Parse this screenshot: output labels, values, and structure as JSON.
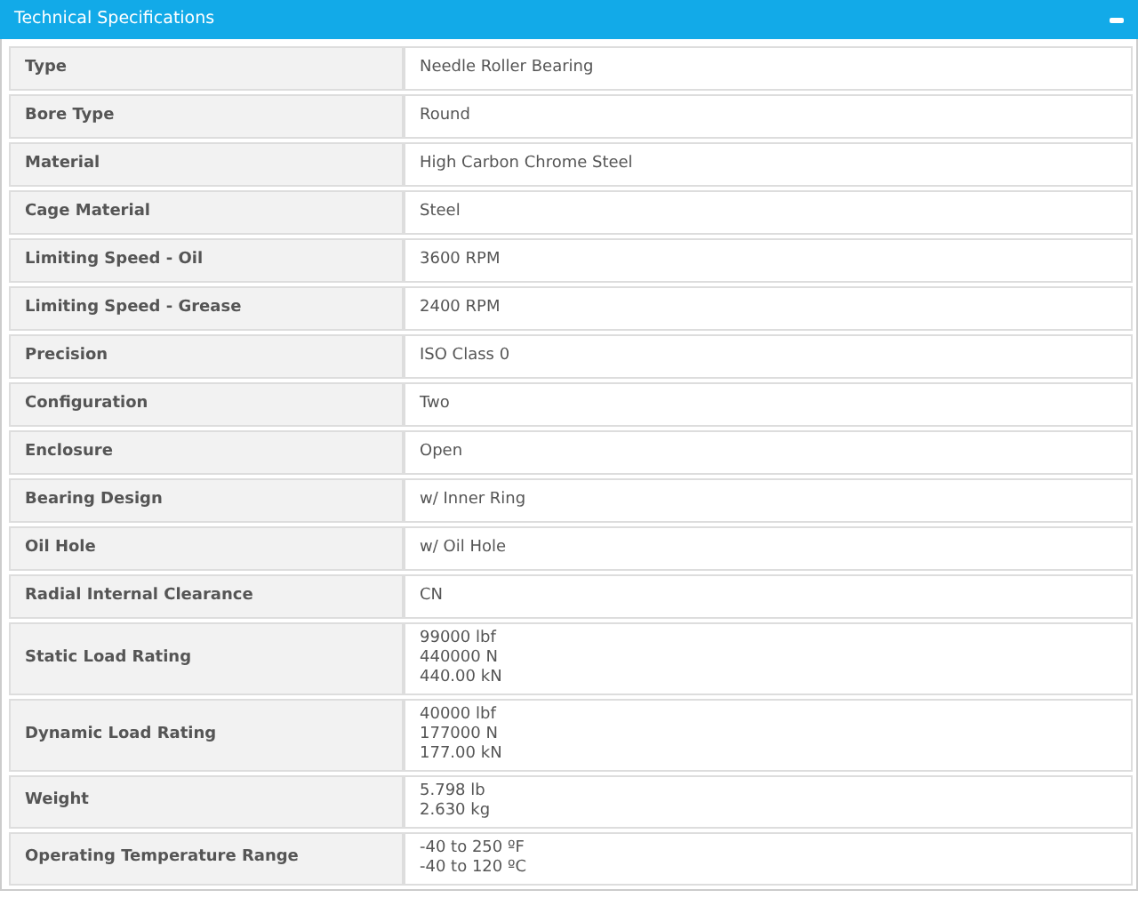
{
  "panel": {
    "title": "Technical Specifications",
    "expanded": true,
    "rows": [
      {
        "label": "Type",
        "values": [
          "Needle Roller Bearing"
        ]
      },
      {
        "label": "Bore Type",
        "values": [
          "Round"
        ]
      },
      {
        "label": "Material",
        "values": [
          "High Carbon Chrome Steel"
        ]
      },
      {
        "label": "Cage Material",
        "values": [
          "Steel"
        ]
      },
      {
        "label": "Limiting Speed - Oil",
        "values": [
          "3600 RPM"
        ]
      },
      {
        "label": "Limiting Speed - Grease",
        "values": [
          "2400 RPM"
        ]
      },
      {
        "label": "Precision",
        "values": [
          "ISO Class 0"
        ]
      },
      {
        "label": "Configuration",
        "values": [
          "Two"
        ]
      },
      {
        "label": "Enclosure",
        "values": [
          "Open"
        ]
      },
      {
        "label": "Bearing Design",
        "values": [
          "w/ Inner Ring"
        ]
      },
      {
        "label": "Oil Hole",
        "values": [
          "w/ Oil Hole"
        ]
      },
      {
        "label": "Radial Internal Clearance",
        "values": [
          "CN"
        ]
      },
      {
        "label": "Static Load Rating",
        "values": [
          "99000 lbf",
          "440000 N",
          "440.00 kN"
        ]
      },
      {
        "label": "Dynamic Load Rating",
        "values": [
          "40000 lbf",
          "177000 N",
          "177.00 kN"
        ]
      },
      {
        "label": "Weight",
        "values": [
          "5.798 lb",
          "2.630 kg"
        ]
      },
      {
        "label": "Operating Temperature Range",
        "values": [
          "-40 to 250 ºF",
          "-40 to 120 ºC"
        ]
      }
    ]
  }
}
